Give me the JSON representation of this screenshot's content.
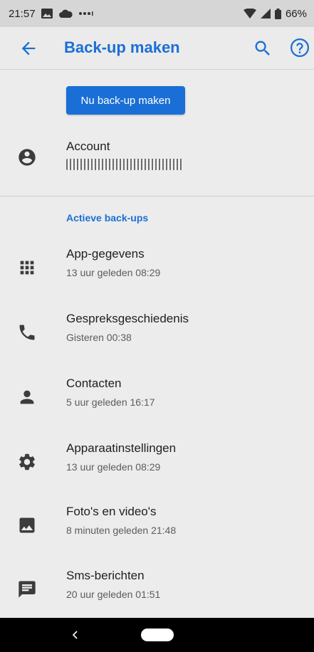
{
  "status_bar": {
    "time": "21:57",
    "battery": "66%",
    "icons": [
      "image-icon",
      "cloud-icon",
      "more-icon",
      "wifi-icon",
      "signal-icon",
      "battery-icon"
    ]
  },
  "app_bar": {
    "title": "Back-up maken",
    "back_icon": "arrow-back-icon",
    "search_icon": "search-icon",
    "help_icon": "help-icon"
  },
  "backup_button": {
    "label": "Nu back-up maken"
  },
  "account": {
    "title": "Account",
    "icon": "account-circle-icon"
  },
  "section": {
    "label": "Actieve back-ups"
  },
  "items": [
    {
      "title": "App-gegevens",
      "subtitle": "13 uur geleden 08:29",
      "icon": "apps-grid-icon"
    },
    {
      "title": "Gespreksgeschiedenis",
      "subtitle": "Gisteren 00:38",
      "icon": "phone-icon"
    },
    {
      "title": "Contacten",
      "subtitle": "5 uur geleden 16:17",
      "icon": "person-icon"
    },
    {
      "title": "Apparaatinstellingen",
      "subtitle": "13 uur geleden 08:29",
      "icon": "settings-gear-icon"
    },
    {
      "title": "Foto's en video's",
      "subtitle": "8 minuten geleden 21:48",
      "icon": "image-icon"
    },
    {
      "title": "Sms-berichten",
      "subtitle": "20 uur geleden 01:51",
      "icon": "message-icon"
    }
  ],
  "colors": {
    "accent": "#1a6fd6",
    "background": "#ececec",
    "icon": "#3c3c3c"
  }
}
